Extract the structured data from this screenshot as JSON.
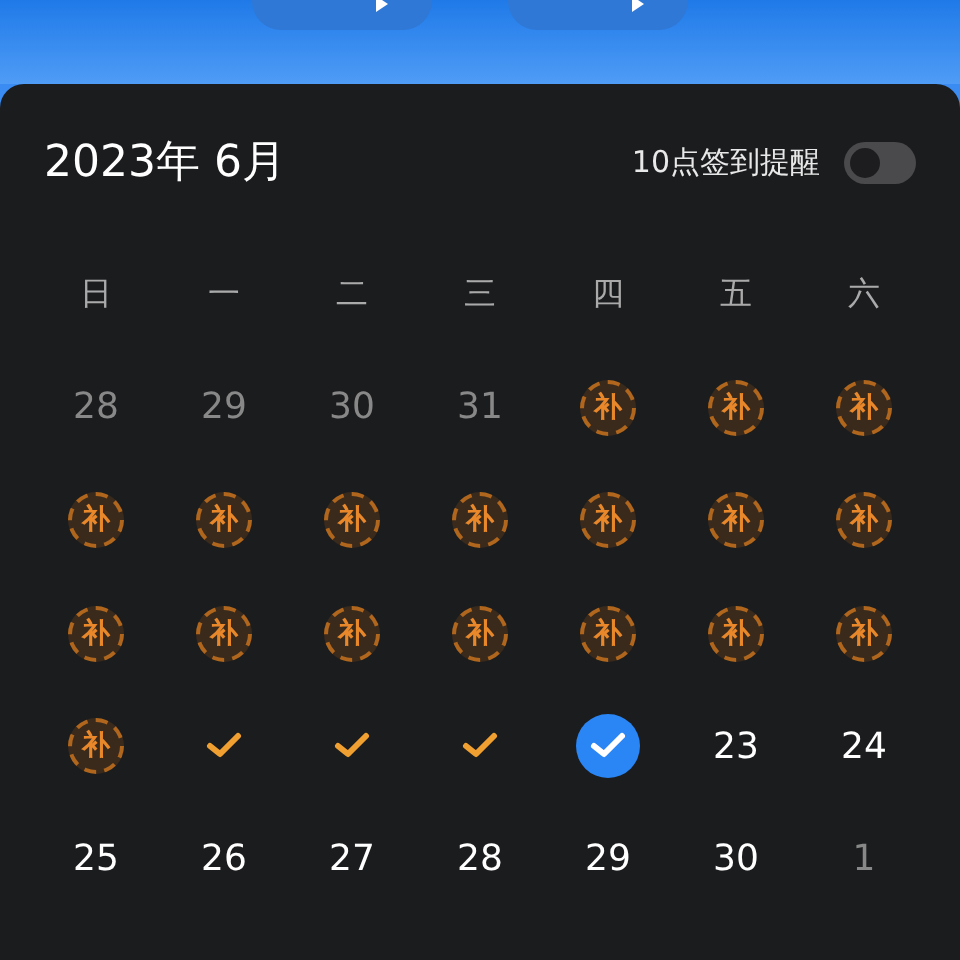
{
  "header": {
    "buttons": [
      {
        "kind": "pill"
      },
      {
        "kind": "pill"
      }
    ]
  },
  "calendar": {
    "title": "2023年 6月",
    "reminder": {
      "label": "10点签到提醒",
      "on": false
    },
    "weekdays": [
      "日",
      "一",
      "二",
      "三",
      "四",
      "五",
      "六"
    ],
    "weeks": [
      [
        {
          "kind": "other",
          "text": "28"
        },
        {
          "kind": "other",
          "text": "29"
        },
        {
          "kind": "other",
          "text": "30"
        },
        {
          "kind": "other",
          "text": "31"
        },
        {
          "kind": "makeup",
          "text": "补"
        },
        {
          "kind": "makeup",
          "text": "补"
        },
        {
          "kind": "makeup",
          "text": "补"
        }
      ],
      [
        {
          "kind": "makeup",
          "text": "补"
        },
        {
          "kind": "makeup",
          "text": "补"
        },
        {
          "kind": "makeup",
          "text": "补"
        },
        {
          "kind": "makeup",
          "text": "补"
        },
        {
          "kind": "makeup",
          "text": "补"
        },
        {
          "kind": "makeup",
          "text": "补"
        },
        {
          "kind": "makeup",
          "text": "补"
        }
      ],
      [
        {
          "kind": "makeup",
          "text": "补"
        },
        {
          "kind": "makeup",
          "text": "补"
        },
        {
          "kind": "makeup",
          "text": "补"
        },
        {
          "kind": "makeup",
          "text": "补"
        },
        {
          "kind": "makeup",
          "text": "补"
        },
        {
          "kind": "makeup",
          "text": "补"
        },
        {
          "kind": "makeup",
          "text": "补"
        }
      ],
      [
        {
          "kind": "makeup",
          "text": "补"
        },
        {
          "kind": "checked"
        },
        {
          "kind": "checked"
        },
        {
          "kind": "checked"
        },
        {
          "kind": "today"
        },
        {
          "kind": "day",
          "text": "23"
        },
        {
          "kind": "day",
          "text": "24"
        }
      ],
      [
        {
          "kind": "day",
          "text": "25"
        },
        {
          "kind": "day",
          "text": "26"
        },
        {
          "kind": "day",
          "text": "27"
        },
        {
          "kind": "day",
          "text": "28"
        },
        {
          "kind": "day",
          "text": "29"
        },
        {
          "kind": "day",
          "text": "30"
        },
        {
          "kind": "other",
          "text": "1"
        }
      ]
    ]
  }
}
